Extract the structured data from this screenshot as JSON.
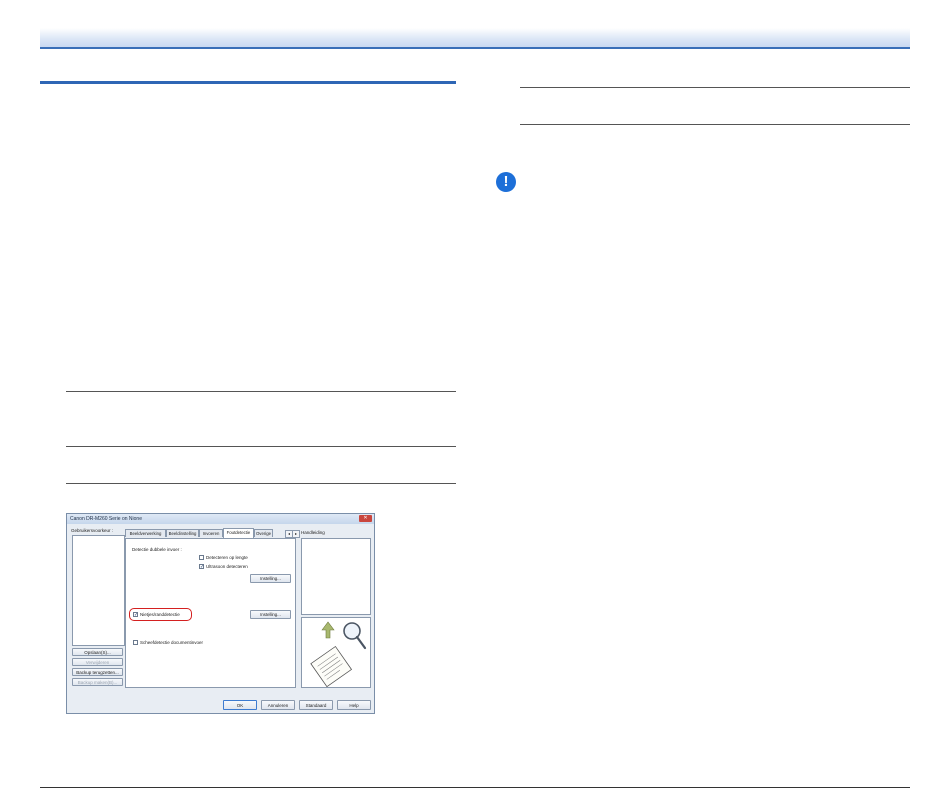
{
  "dialog": {
    "title": "Canon DR-M260 Serie on Nione",
    "close_glyph": "✕",
    "user_settings_label": "Gebruikersvoorkeur :",
    "side_buttons": {
      "save": "Opslaan(S)...",
      "delete": "Verwijderen",
      "restore_backup": "Backup terugzetten...",
      "make_backup": "Backup maken(B)..."
    },
    "tabs": [
      "Beeldverwerking",
      "Beeldinstelling",
      "Invoeren",
      "Foutdetectie",
      "Overige"
    ],
    "active_tab": "Foutdetectie",
    "tab_arrows": [
      "◂",
      "▸"
    ],
    "panel": {
      "double_feed_label": "Detectie dubbele invoer :",
      "detect_length": "Detecteren op lengte",
      "ultrasonic": "Ultrasoon detecteren",
      "settings_button_1": "Instelling...",
      "staple_detection": "Nietjes/randdetectie",
      "settings_button_2": "Instelling...",
      "skew_detection": "Scheefdetectie documentinvoer"
    },
    "checkmark": "✓",
    "help_label": "Handleiding",
    "bottom_buttons": {
      "ok": "OK",
      "cancel": "Annuleren",
      "default": "Standaard",
      "help": "Help"
    }
  },
  "notice_icon_glyph": "!",
  "colors": {
    "accent_blue": "#2e66b5",
    "notice_blue": "#1d6fd8",
    "highlight_red": "#d42020"
  }
}
